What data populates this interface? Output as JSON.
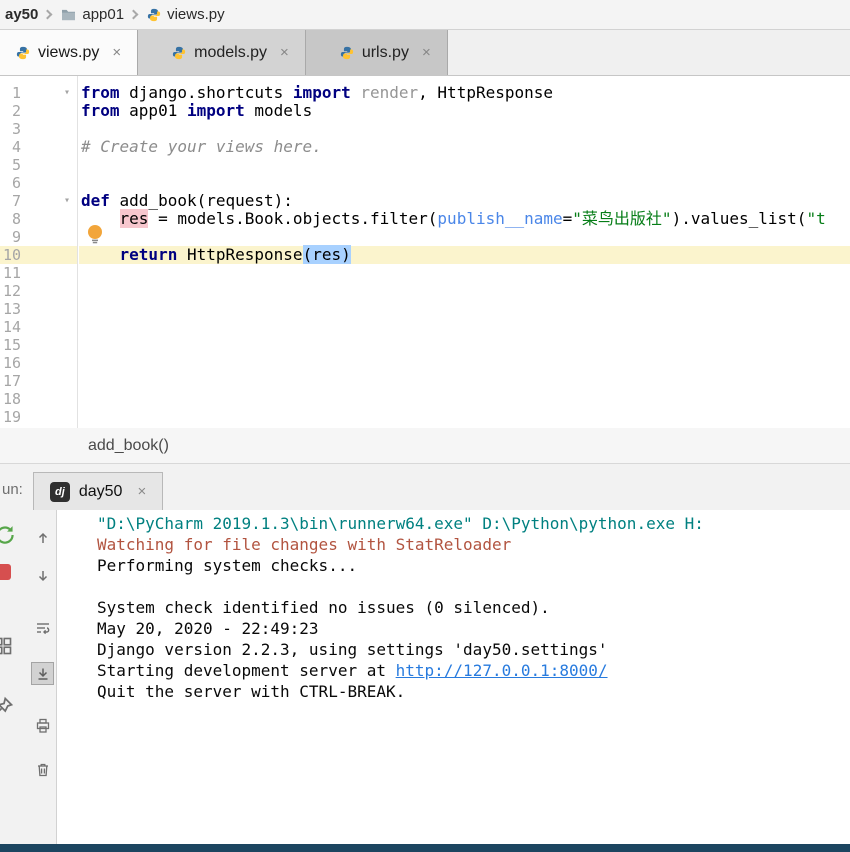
{
  "breadcrumb_top": {
    "project": "ay50",
    "folder": "app01",
    "file": "views.py"
  },
  "tabs": [
    {
      "label": "views.py",
      "active": true
    },
    {
      "label": "models.py",
      "active": false
    },
    {
      "label": "urls.py",
      "active": false
    }
  ],
  "editor": {
    "line_count": 19,
    "current_line": 10,
    "lightbulb_line": 9,
    "fold_lines": [
      1,
      7
    ],
    "lines": [
      [
        {
          "t": "from",
          "c": "kw"
        },
        {
          "t": " django.shortcuts ",
          "c": "txt"
        },
        {
          "t": "import",
          "c": "kw"
        },
        {
          "t": " ",
          "c": "txt"
        },
        {
          "t": "render",
          "c": "unused"
        },
        {
          "t": ", HttpResponse",
          "c": "txt"
        }
      ],
      [
        {
          "t": "from",
          "c": "kw"
        },
        {
          "t": " app01 ",
          "c": "txt"
        },
        {
          "t": "import",
          "c": "kw"
        },
        {
          "t": " models",
          "c": "txt"
        }
      ],
      [],
      [
        {
          "t": "# Create your views here.",
          "c": "com"
        }
      ],
      [],
      [],
      [
        {
          "t": "def ",
          "c": "kw"
        },
        {
          "t": "add_book(request):",
          "c": "txt"
        }
      ],
      [
        {
          "t": "    ",
          "c": "txt"
        },
        {
          "t": "res",
          "c": "wr"
        },
        {
          "t": " = models.Book.objects.filter(",
          "c": "txt"
        },
        {
          "t": "publish__name",
          "c": "arg"
        },
        {
          "t": "=",
          "c": "txt"
        },
        {
          "t": "\"菜鸟出版社\"",
          "c": "str"
        },
        {
          "t": ").values_list(",
          "c": "txt"
        },
        {
          "t": "\"t",
          "c": "str"
        }
      ],
      [],
      [
        {
          "t": "    ",
          "c": "txt"
        },
        {
          "t": "return",
          "c": "kw"
        },
        {
          "t": " HttpResponse",
          "c": "txt"
        },
        {
          "t": "(res)",
          "c": "sel"
        }
      ],
      [],
      [],
      [],
      [],
      [],
      [],
      [],
      [],
      []
    ]
  },
  "breadcrumb_bottom": {
    "label": "add_book()"
  },
  "run": {
    "label_visible": "un:",
    "tab_label": "day50",
    "icon_text": "dj",
    "close_label": "×"
  },
  "console": {
    "toolbar_icons": [
      "rerun",
      "stop",
      "layout",
      "pin",
      "scroll-up",
      "scroll-down",
      "soft-wrap",
      "scroll-to-end",
      "print",
      "clear"
    ],
    "selected_tool": "scroll-to-end",
    "lines": [
      [
        {
          "t": "\"D:\\PyCharm 2019.1.3\\bin\\runnerw64.exe\" D:\\Python\\python.exe H:",
          "c": "cmd"
        }
      ],
      [
        {
          "t": "Watching for file changes with StatReloader",
          "c": "err"
        }
      ],
      [
        {
          "t": "Performing system checks...",
          "c": "out"
        }
      ],
      [
        {
          "t": "",
          "c": "out"
        }
      ],
      [
        {
          "t": "System check identified no issues (0 silenced).",
          "c": "out"
        }
      ],
      [
        {
          "t": "May 20, 2020 - 22:49:23",
          "c": "out"
        }
      ],
      [
        {
          "t": "Django version 2.2.3, using settings 'day50.settings'",
          "c": "out"
        }
      ],
      [
        {
          "t": "Starting development server at ",
          "c": "out"
        },
        {
          "t": "http://127.0.0.1:8000/",
          "c": "link"
        }
      ],
      [
        {
          "t": "Quit the server with CTRL-BREAK.",
          "c": "out"
        }
      ]
    ]
  },
  "colors": {
    "keyword": "#000080",
    "string": "#067d17",
    "comment": "#8c8c8c",
    "caret_row": "#fbf4cd",
    "selection": "#a8d1ff",
    "write_highlight": "#f7c7ce",
    "console_cmd": "#008080",
    "console_error": "#b25440",
    "link": "#287bde",
    "bottom_bar": "#1c4560"
  }
}
